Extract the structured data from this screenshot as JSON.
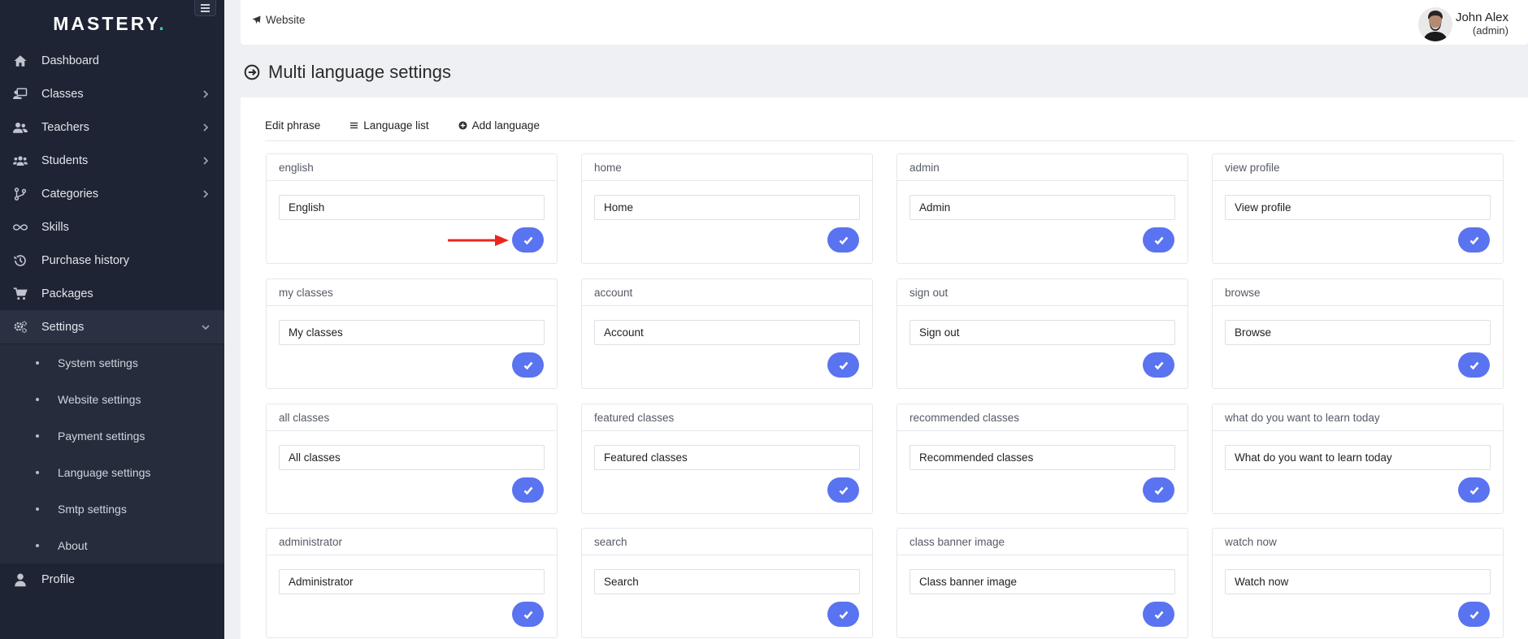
{
  "brand": {
    "name": "MASTERY",
    "dot": "."
  },
  "sidebar": {
    "items": [
      {
        "label": "Dashboard",
        "icon": "home-icon",
        "has_chevron": false
      },
      {
        "label": "Classes",
        "icon": "chalkboard-teacher-icon",
        "has_chevron": true
      },
      {
        "label": "Teachers",
        "icon": "user-group-icon",
        "has_chevron": true
      },
      {
        "label": "Students",
        "icon": "users-icon",
        "has_chevron": true
      },
      {
        "label": "Categories",
        "icon": "branch-icon",
        "has_chevron": true
      },
      {
        "label": "Skills",
        "icon": "infinity-icon",
        "has_chevron": false
      },
      {
        "label": "Purchase history",
        "icon": "history-icon",
        "has_chevron": false
      },
      {
        "label": "Packages",
        "icon": "cart-icon",
        "has_chevron": false
      },
      {
        "label": "Settings",
        "icon": "cogs-icon",
        "has_chevron": true,
        "expanded": true
      },
      {
        "label": "Profile",
        "icon": "user-icon",
        "has_chevron": false
      }
    ],
    "settings_submenu": [
      "System settings",
      "Website settings",
      "Payment settings",
      "Language settings",
      "Smtp settings",
      "About"
    ]
  },
  "topbar": {
    "website_label": "Website",
    "user_name": "John Alex",
    "user_role": "(admin)"
  },
  "page": {
    "title": "Multi language settings"
  },
  "tabs": [
    {
      "label": "Edit phrase",
      "icon": ""
    },
    {
      "label": "Language list",
      "icon": "list-icon"
    },
    {
      "label": "Add language",
      "icon": "plus-circle-icon"
    }
  ],
  "phrases": [
    {
      "key": "english",
      "value": "English"
    },
    {
      "key": "home",
      "value": "Home"
    },
    {
      "key": "admin",
      "value": "Admin"
    },
    {
      "key": "view profile",
      "value": "View profile"
    },
    {
      "key": "my classes",
      "value": "My classes"
    },
    {
      "key": "account",
      "value": "Account"
    },
    {
      "key": "sign out",
      "value": "Sign out"
    },
    {
      "key": "browse",
      "value": "Browse"
    },
    {
      "key": "all classes",
      "value": "All classes"
    },
    {
      "key": "featured classes",
      "value": "Featured classes"
    },
    {
      "key": "recommended classes",
      "value": "Recommended classes"
    },
    {
      "key": "what do you want to learn today",
      "value": "What do you want to learn today"
    },
    {
      "key": "administrator",
      "value": "Administrator"
    },
    {
      "key": "search",
      "value": "Search"
    },
    {
      "key": "class banner image",
      "value": "Class banner image"
    },
    {
      "key": "watch now",
      "value": "Watch now"
    }
  ],
  "colors": {
    "sidebar_bg": "#1e2433",
    "accent": "#5a73f0",
    "logo_dot": "#2fd3a0",
    "annotation_arrow": "#e8281e"
  }
}
